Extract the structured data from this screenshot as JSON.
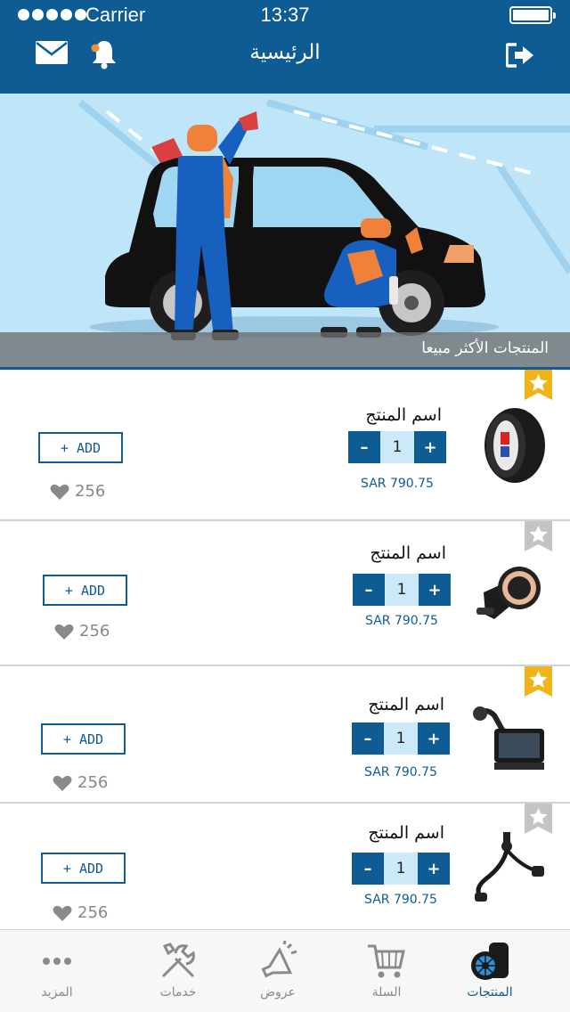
{
  "status_bar": {
    "carrier": "Carrier",
    "time": "13:37"
  },
  "header": {
    "title": "الرئيسية",
    "mail_icon": "mail-icon",
    "bell_icon": "bell-icon",
    "logout_icon": "logout-icon"
  },
  "hero": {
    "caption": "المنتجات الأكثر مبيعا"
  },
  "products": [
    {
      "name": "اسم المنتج",
      "qty": "1",
      "price": "SAR  790.75",
      "add_label": "+ ADD",
      "likes": "256",
      "favorite": true,
      "thumb": "tire"
    },
    {
      "name": "اسم المنتج",
      "qty": "1",
      "price": "SAR  790.75",
      "add_label": "+ ADD",
      "likes": "256",
      "favorite": false,
      "thumb": "phone-holder"
    },
    {
      "name": "اسم المنتج",
      "qty": "1",
      "price": "SAR  790.75",
      "add_label": "+ ADD",
      "likes": "256",
      "favorite": true,
      "thumb": "gps"
    },
    {
      "name": "اسم المنتج",
      "qty": "1",
      "price": "SAR  790.75",
      "add_label": "+ ADD",
      "likes": "256",
      "favorite": false,
      "thumb": "mount"
    }
  ],
  "stepper": {
    "minus": "–",
    "plus": "+"
  },
  "tabs": [
    {
      "label": "المزيد",
      "icon": "more-icon"
    },
    {
      "label": "خدمات",
      "icon": "tools-icon"
    },
    {
      "label": "عروض",
      "icon": "megaphone-icon"
    },
    {
      "label": "السلة",
      "icon": "cart-icon"
    },
    {
      "label": "المنتجات",
      "icon": "tires-icon"
    }
  ],
  "colors": {
    "primary": "#0f5c95",
    "hero_bg": "#bfe6f8",
    "star_active": "#f2b318",
    "star_inactive": "#c4c4c4"
  }
}
